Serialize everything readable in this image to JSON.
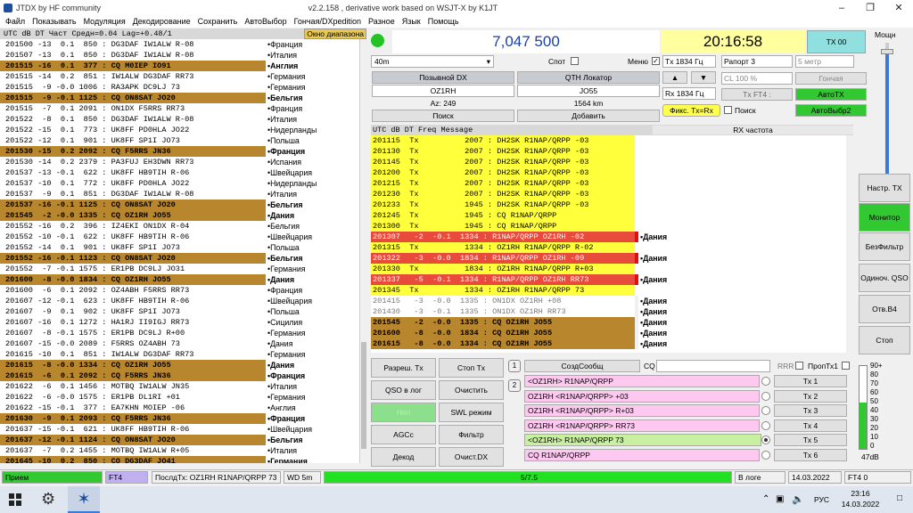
{
  "title": "JTDX  by HF community",
  "title_right": "v2.2.158 , derivative work based on WSJT-X by K1JT",
  "menu": [
    "Файл",
    "Показывать",
    "Модуляция",
    "Декодирование",
    "Сохранить",
    "АвтоВыбор",
    "Гончая/DXpedition",
    "Разное",
    "Язык",
    "Помощь"
  ],
  "left_header": {
    "cols": "UTC    dB  DT  Част   Средн=0.04 Lag=+0.48/1",
    "diap": "Окно диапазона"
  },
  "band_rows": [
    {
      "m": "201500 -13  0.1  850 : DG3DAF IW1ALW R-08",
      "c": "Франция",
      "cq": false
    },
    {
      "m": "201507 -13  0.1  850 : DG3DAF IW1ALW R-08",
      "c": "Италия",
      "cq": false
    },
    {
      "m": "201515 -16  0.1  377 : CQ M0IEP IO91",
      "c": "Англия",
      "cq": true
    },
    {
      "m": "201515 -14  0.2  851 : IW1ALW DG3DAF RR73",
      "c": "Германия",
      "cq": false
    },
    {
      "m": "201515  -9 -0.0 1006 : RA3APK DC9LJ 73",
      "c": "Германия",
      "cq": false
    },
    {
      "m": "201515  -9 -0.1 1125 : CQ ON8SAT JO20",
      "c": "Бельгия",
      "cq": true
    },
    {
      "m": "201515  -7  0.1 2091 : ON1DX F5RRS RR73",
      "c": "Франция",
      "cq": false
    },
    {
      "m": "201522  -8  0.1  850 : DG3DAF IW1ALW R-08",
      "c": "Италия",
      "cq": false
    },
    {
      "m": "201522 -15  0.1  773 : UK8FF PD0HLA JO22",
      "c": "Нидерланды",
      "cq": false
    },
    {
      "m": "201522 -12  0.1  901 : UK8FF SP1I JO73",
      "c": "Польша",
      "cq": false
    },
    {
      "m": "201530 -15  0.2 2092 : CQ F5RRS JN36",
      "c": "Франция",
      "cq": true
    },
    {
      "m": "201530 -14  0.2 2379 : PA3FUJ EH3DWN RR73",
      "c": "Испания",
      "cq": false
    },
    {
      "m": "201537 -13 -0.1  622 : UK8FF HB9TIH R-06",
      "c": "Швейцария",
      "cq": false
    },
    {
      "m": "201537 -10  0.1  772 : UK8FF PD0HLA JO22",
      "c": "Нидерланды",
      "cq": false
    },
    {
      "m": "201537  -9  0.1  851 : DG3DAF IW1ALW R-08",
      "c": "Италия",
      "cq": false
    },
    {
      "m": "201537 -16 -0.1 1125 : CQ ON8SAT JO20",
      "c": "Бельгия",
      "cq": true
    },
    {
      "m": "201545  -2 -0.0 1335 : CQ OZ1RH JO55",
      "c": "Дания",
      "cq": true
    },
    {
      "m": "201552 -16  0.2  396 : IZ4EKI ON1DX R-04",
      "c": "Бельгия",
      "cq": false
    },
    {
      "m": "201552 -10 -0.1  622 : UK8FF HB9TIH R-06",
      "c": "Швейцария",
      "cq": false
    },
    {
      "m": "201552 -14  0.1  901 : UK8FF SP1I JO73",
      "c": "Польша",
      "cq": false
    },
    {
      "m": "201552 -16 -0.1 1123 : CQ ON8SAT JO20",
      "c": "Бельгия",
      "cq": true
    },
    {
      "m": "201552  -7 -0.1 1575 : ER1PB DC9LJ JO31",
      "c": "Германия",
      "cq": false
    },
    {
      "m": "201600  -8 -0.0 1834 : CQ OZ1RH JO55",
      "c": "Дания",
      "cq": true
    },
    {
      "m": "201600  -6  0.1 2092 : OZ4ABH F5RRS RR73",
      "c": "Франция",
      "cq": false
    },
    {
      "m": "201607 -12 -0.1  623 : UK8FF HB9TIH R-06",
      "c": "Швейцария",
      "cq": false
    },
    {
      "m": "201607  -9  0.1  902 : UK8FF SP1I JO73",
      "c": "Польша",
      "cq": false
    },
    {
      "m": "201607 -16  0.1 1272 : HA1RJ II9IGJ RR73",
      "c": "Сицилия",
      "cq": false
    },
    {
      "m": "201607  -8 -0.1 1575 : ER1PB DC9LJ R+00",
      "c": "Германия",
      "cq": false
    },
    {
      "m": "201607 -15 -0.0 2089 : F5RRS OZ4ABH 73",
      "c": "Дания",
      "cq": false
    },
    {
      "m": "201615 -10  0.1  851 : IW1ALW DG3DAF RR73",
      "c": "Германия",
      "cq": false
    },
    {
      "m": "201615  -8 -0.0 1334 : CQ OZ1RH JO55",
      "c": "Дания",
      "cq": true
    },
    {
      "m": "201615  -6  0.1 2092 : CQ F5RRS JN36",
      "c": "Франция",
      "cq": true
    },
    {
      "m": "201622  -6  0.1 1456 : MOTBQ IW1ALW JN35",
      "c": "Италия",
      "cq": false
    },
    {
      "m": "201622  -6 -0.0 1575 : ER1PB DL1RI +01",
      "c": "Германия",
      "cq": false
    },
    {
      "m": "201622 -15 -0.1  377 : EA7KHN MOIEP -06",
      "c": "Англия",
      "cq": false
    },
    {
      "m": "201630  -9  0.1 2093 : CQ F5RRS JN36",
      "c": "Франция",
      "cq": true
    },
    {
      "m": "201637 -15 -0.1  621 : UK8FF HB9TIH R-06",
      "c": "Швейцария",
      "cq": false
    },
    {
      "m": "201637 -12 -0.1 1124 : CQ ON8SAT JO20",
      "c": "Бельгия",
      "cq": true
    },
    {
      "m": "201637  -7  0.2 1455 : MOTBQ IW1ALW R+05",
      "c": "Италия",
      "cq": false
    },
    {
      "m": "201645 -10  0.2  850 : CQ DG3DAF JO41",
      "c": "Германия",
      "cq": true
    }
  ],
  "top": {
    "freq": "7,047 500",
    "clock": "20:16:58",
    "tx_status": "TX 00",
    "power_label": "Мощн",
    "band": "40m",
    "spot_label": "Спот",
    "menu_label": "Меню",
    "tx_hz": "Tx  1834  Гц",
    "rx_hz": "Rx  1834  Гц",
    "report": "Рапорт 3",
    "meters": "5 метр",
    "cl": "CL  100 %",
    "honch": "Гончая",
    "txft4": "Tx FT4 :",
    "autotx": "АвтоTX",
    "fix": "Фикс. Tx=Rx",
    "search_chk": "Поиск",
    "autosel": "АвтоВыбр2",
    "dx_hdr": "Позывной DX",
    "qth_hdr": "QTH Локатор",
    "dx_call": "OZ1RH",
    "dx_loc": "JO55",
    "az": "Az: 249",
    "dist": "1564 km",
    "find": "Поиск",
    "add": "Добавить"
  },
  "traffic_header": {
    "cols": "UTC      dB    DT  Freq      Message",
    "rx": "RX частота"
  },
  "traffic_rows": [
    {
      "m": "201115  Tx          2007 : DH2SK R1NAP/QRPP -03",
      "t": "tx",
      "c": ""
    },
    {
      "m": "201130  Tx          2007 : DH2SK R1NAP/QRPP -03",
      "t": "tx",
      "c": ""
    },
    {
      "m": "201145  Tx          2007 : DH2SK R1NAP/QRPP -03",
      "t": "tx",
      "c": ""
    },
    {
      "m": "201200  Tx          2007 : DH2SK R1NAP/QRPP -03",
      "t": "tx",
      "c": ""
    },
    {
      "m": "201215  Tx          2007 : DH2SK R1NAP/QRPP -03",
      "t": "tx",
      "c": ""
    },
    {
      "m": "201230  Tx          2007 : DH2SK R1NAP/QRPP -03",
      "t": "tx",
      "c": ""
    },
    {
      "m": "201233  Tx          1945 : DH2SK R1NAP/QRPP -03",
      "t": "tx",
      "c": ""
    },
    {
      "m": "201245  Tx          1945 : CQ R1NAP/QRPP",
      "t": "tx",
      "c": ""
    },
    {
      "m": "201300  Tx          1945 : CQ R1NAP/QRPP",
      "t": "tx",
      "c": ""
    },
    {
      "m": "201307   -2  -0.1  1334 : R1NAP/QRPP OZ1RH -02",
      "t": "red",
      "c": "Дания"
    },
    {
      "m": "201315  Tx          1334 : OZ1RH R1NAP/QRPP R-02",
      "t": "tx",
      "c": ""
    },
    {
      "m": "201322   -3  -0.0  1834 : R1NAP/QRPP OZ1RH -09",
      "t": "red",
      "c": "Дания"
    },
    {
      "m": "201330  Tx          1834 : OZ1RH R1NAP/QRPP R+03",
      "t": "tx",
      "c": ""
    },
    {
      "m": "201337   -5  -0.1  1334 : R1NAP/QRPP OZ1RH RR73",
      "t": "red",
      "c": "Дания"
    },
    {
      "m": "201345  Tx          1334 : OZ1RH R1NAP/QRPP 73",
      "t": "tx",
      "c": ""
    },
    {
      "m": "201415   -3  -0.0  1335 : ON1DX OZ1RH +08",
      "t": "grey",
      "c": "Дания"
    },
    {
      "m": "201430   -3  -0.1  1335 : ON1DX OZ1RH RR73",
      "t": "grey",
      "c": "Дания"
    },
    {
      "m": "201545   -2  -0.0  1335 : CQ OZ1RH JO55",
      "t": "cq",
      "c": "Дания"
    },
    {
      "m": "201600   -8  -0.0  1834 : CQ OZ1RH JO55",
      "t": "cq",
      "c": "Дания"
    },
    {
      "m": "201615   -8  -0.0  1334 : CQ OZ1RH JO55",
      "t": "cq",
      "c": "Дания"
    }
  ],
  "right_buttons": [
    "Настр. TX",
    "Монитор",
    "БезФильтр",
    "Одиноч. QSO",
    "Отв.В4",
    "Стоп"
  ],
  "ctrl_buttons": [
    "Разреш. Tx",
    "Стоп Tx",
    "QSO в лог",
    "Очистить",
    "Нпп",
    "SWL режим",
    "AGCc",
    "Фильтр",
    "Декод",
    "Очист.DX"
  ],
  "msgs": {
    "gen": "СоздСообщ",
    "cq": "CQ",
    "rrr": "RRR",
    "proptx": "ПропТх1",
    "tab1": "1",
    "tab2": "2",
    "tx": [
      {
        "t": "<OZ1RH> R1NAP/QRPP",
        "b": "Tx 1"
      },
      {
        "t": "OZ1RH <R1NAP/QRPP> +03",
        "b": "Tx 2"
      },
      {
        "t": "OZ1RH <R1NAP/QRPP> R+03",
        "b": "Tx 3"
      },
      {
        "t": "OZ1RH <R1NAP/QRPP> RR73",
        "b": "Tx 4"
      },
      {
        "t": "<OZ1RH> R1NAP/QRPP 73",
        "b": "Tx 5"
      },
      {
        "t": "CQ R1NAP/QRPP",
        "b": "Tx 6"
      }
    ]
  },
  "meter": {
    "scale": [
      "90+",
      "80",
      "70",
      "60",
      "50",
      "40",
      "30",
      "20",
      "10",
      "0"
    ],
    "db": "47dB"
  },
  "status": {
    "rx": "Прием",
    "mode": "FT4",
    "last": "ПослдТх: OZ1RH R1NAP/QRPP 73",
    "wd": "WD 5m",
    "prog": "5/7.5",
    "log": "В логе",
    "date": "14.03.2022",
    "ft4": "FT4  0"
  },
  "taskbar": {
    "lang": "РУС",
    "time": "23:16",
    "date": "14.03.2022"
  },
  "colors": {
    "cq_band": "#b8862d",
    "tx_yellow": "#ffff3c",
    "red": "#e84a3c",
    "green": "#22c322",
    "pink": "#ffc8f0"
  }
}
